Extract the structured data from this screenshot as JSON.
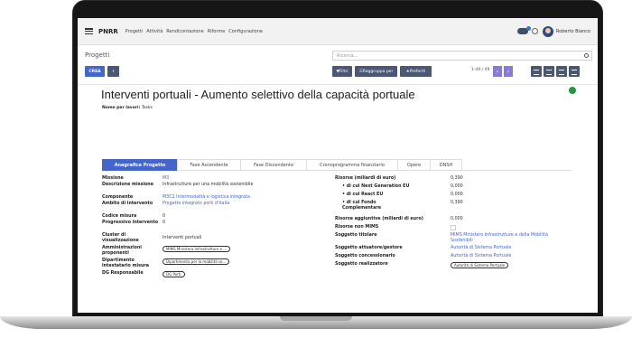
{
  "navbar": {
    "app_name": "PNRR",
    "menu": [
      "Progetti",
      "Attività",
      "Rendicontazione",
      "Riforme",
      "Configurazione"
    ],
    "user_name": "Roberto Bianco"
  },
  "control": {
    "breadcrumb": "Progetti",
    "search_placeholder": "Ricerca...",
    "create_label": "CREA",
    "filters_label": "▼Filtri",
    "group_label": "☰Raggruppa per",
    "favorites_label": "★Preferiti",
    "pager": "1-49 / 49"
  },
  "form": {
    "title": "Interventi portuali - Aumento selettivo della capacità portuale",
    "subtitle_label": "Nome per lavori:",
    "subtitle_value": "Tasks"
  },
  "tabs": [
    "Anagrafica Progetto",
    "Fase Ascendente",
    "Fase Discendente",
    "Cronoprogramma finanziario",
    "Opere",
    "DNSH"
  ],
  "left_fields": [
    {
      "label": "Missione",
      "value": "M3",
      "type": "link"
    },
    {
      "label": "Descrizione missione",
      "value": "Infrastrutture per una mobilità sostenibile",
      "type": "text"
    },
    {
      "label": "Componente",
      "value": "M3C2 Intermodalità e logistica integrata",
      "type": "link"
    },
    {
      "label": "Ambito di intervento",
      "value": "Progetto integrato porti d'Italia",
      "type": "link"
    },
    {
      "label": "Codice misura",
      "value": "0",
      "type": "text"
    },
    {
      "label": "Progressivo intervento",
      "value": "0",
      "type": "text"
    },
    {
      "label": "Cluster di visualizzazione",
      "value": "Interventi portuali",
      "type": "text"
    },
    {
      "label": "Amministrazioni proponenti",
      "value": "MIMS Ministero Infrastrutture e ...",
      "type": "pill"
    },
    {
      "label": "Dipartimento intestatario misura",
      "value": "Dipartimento per la mobilità so...",
      "type": "pill"
    },
    {
      "label": "DG Responsabile",
      "value": "DG Porti",
      "type": "pill"
    }
  ],
  "right_fields": [
    {
      "label": "Risorse (miliardi di euro)",
      "value": "0,390",
      "type": "text",
      "bullet": false
    },
    {
      "label": "di cui Next Generation EU",
      "value": "0,000",
      "type": "text",
      "bullet": true
    },
    {
      "label": "di cui React EU",
      "value": "0,000",
      "type": "text",
      "bullet": true
    },
    {
      "label": "di cui Fondo Complementare",
      "value": "0,390",
      "type": "text",
      "bullet": true
    },
    {
      "label": "Risorse aggiuntive (miliardi di euro)",
      "value": "0,000",
      "type": "text",
      "bullet": false
    },
    {
      "label": "Risorse non MIMS",
      "value": "",
      "type": "checkbox",
      "bullet": false
    },
    {
      "label": "Soggetto titolare",
      "value": "MIMS Ministero Infrastrutture e della Mobilità Sostenibili",
      "type": "link",
      "bullet": false
    },
    {
      "label": "Soggetto attuatore/gestore",
      "value": "Autorità di Sistema Portuale",
      "type": "link",
      "bullet": false
    },
    {
      "label": "Soggetto concessionario",
      "value": "Autorità di Sistema Portuale",
      "type": "link",
      "bullet": false
    },
    {
      "label": "Soggetto realizzatore",
      "value": "Autorità di Sistema Portuale",
      "type": "pill",
      "bullet": false
    }
  ],
  "colors": {
    "primary": "#4466cc",
    "dark_button": "#4a5875",
    "pager": "#8a7ad6",
    "status": "#1e9a3c"
  }
}
